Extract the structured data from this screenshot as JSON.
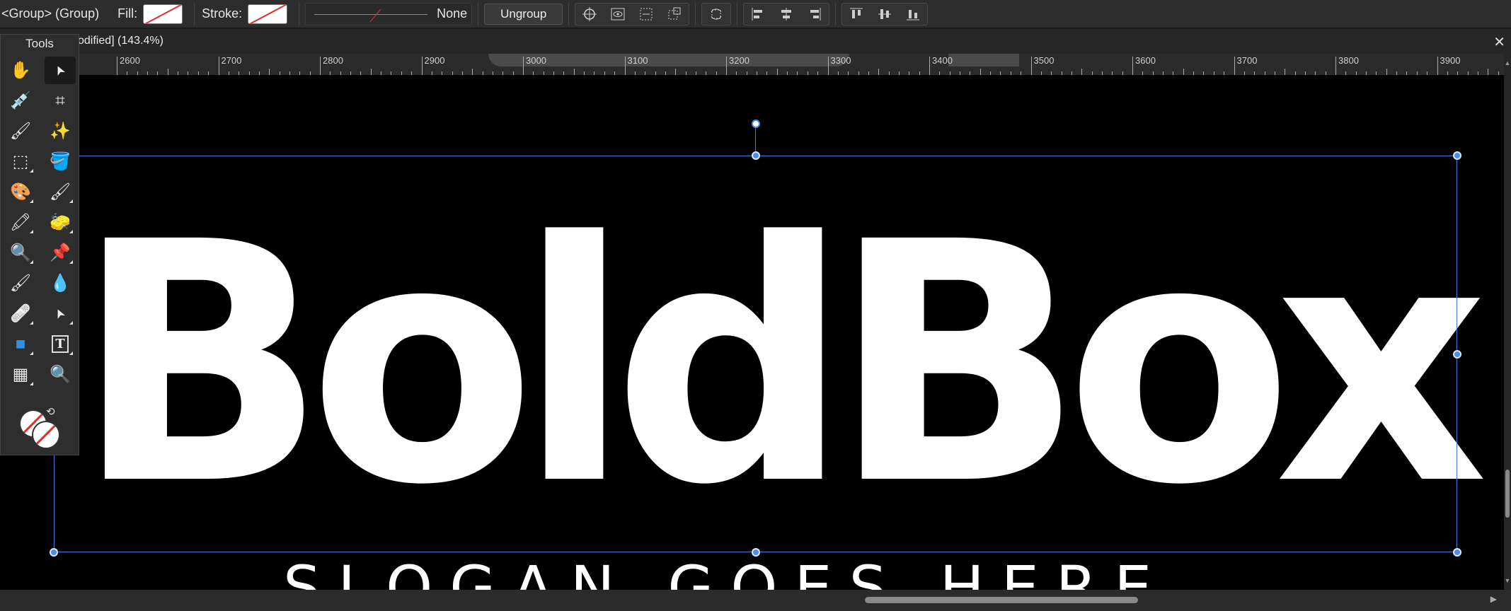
{
  "context_toolbar": {
    "selection_label": "<Group> (Group)",
    "fill_label": "Fill:",
    "stroke_label": "Stroke:",
    "stroke_style_value": "None",
    "ungroup_label": "Ungroup"
  },
  "document": {
    "tab_title": "odified] (143.4%)",
    "close_glyph": "✕"
  },
  "ruler": {
    "labels": [
      "2600",
      "2700",
      "2800",
      "2900",
      "3000",
      "3100",
      "3200",
      "3300",
      "3400",
      "3500",
      "3600",
      "3700",
      "3800",
      "3900"
    ]
  },
  "canvas": {
    "brand_text": "BoldBox",
    "slogan_text": "SLOGAN GOES HERE",
    "background_color": "#000000",
    "text_color": "#ffffff",
    "selection_color": "#3d7bd9"
  },
  "tools_panel": {
    "title": "Tools",
    "tools": [
      {
        "name": "view-tool-hand-icon",
        "glyph": "✋"
      },
      {
        "name": "move-tool-icon",
        "glyph": "➤"
      },
      {
        "name": "color-picker-tool-icon",
        "glyph": "💉"
      },
      {
        "name": "crop-tool-icon",
        "glyph": "⌗"
      },
      {
        "name": "paint-brush-selection-icon",
        "glyph": "🖌"
      },
      {
        "name": "flood-select-wand-icon",
        "glyph": "✨"
      },
      {
        "name": "marquee-selection-icon",
        "glyph": "⬚"
      },
      {
        "name": "flood-fill-bucket-icon",
        "glyph": "🪣"
      },
      {
        "name": "color-replacement-icon",
        "glyph": "🎨"
      },
      {
        "name": "paint-brush-tool-icon",
        "glyph": "🖌"
      },
      {
        "name": "pixel-brush-icon",
        "glyph": "🖍"
      },
      {
        "name": "erase-brush-icon",
        "glyph": "🧽"
      },
      {
        "name": "dodge-burn-icon",
        "glyph": "🔍"
      },
      {
        "name": "clone-stamp-icon",
        "glyph": "📌"
      },
      {
        "name": "smudge-brush-icon",
        "glyph": "🖌"
      },
      {
        "name": "blur-brush-icon",
        "glyph": "💧"
      },
      {
        "name": "healing-brush-icon",
        "glyph": "🩹"
      },
      {
        "name": "node-tool-icon",
        "glyph": "➤"
      },
      {
        "name": "rectangle-tool-icon",
        "glyph": "■"
      },
      {
        "name": "text-tool-icon",
        "glyph": "T"
      },
      {
        "name": "mesh-warp-icon",
        "glyph": "▦"
      },
      {
        "name": "zoom-tool-icon",
        "glyph": "🔍"
      }
    ]
  }
}
